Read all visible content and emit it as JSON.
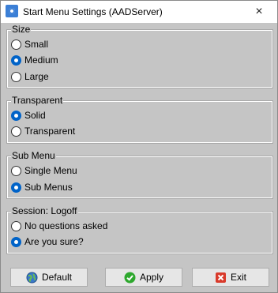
{
  "window": {
    "title": "Start Menu Settings (AADServer)",
    "close_glyph": "×",
    "app_icon": "settings-app-icon"
  },
  "groups": {
    "size": {
      "label": "Size",
      "options": [
        {
          "label": "Small",
          "checked": false
        },
        {
          "label": "Medium",
          "checked": true
        },
        {
          "label": "Large",
          "checked": false
        }
      ]
    },
    "transparent": {
      "label": "Transparent",
      "options": [
        {
          "label": "Solid",
          "checked": true
        },
        {
          "label": "Transparent",
          "checked": false
        }
      ]
    },
    "submenu": {
      "label": "Sub Menu",
      "options": [
        {
          "label": "Single Menu",
          "checked": false
        },
        {
          "label": "Sub Menus",
          "checked": true
        }
      ]
    },
    "logoff": {
      "label": "Session: Logoff",
      "options": [
        {
          "label": "No questions asked",
          "checked": false
        },
        {
          "label": "Are you sure?",
          "checked": true
        }
      ]
    }
  },
  "buttons": {
    "default_label": "Default",
    "apply_label": "Apply",
    "exit_label": "Exit",
    "default_icon": "globe-icon",
    "apply_icon": "checkmark-icon",
    "exit_icon": "close-x-icon"
  },
  "colors": {
    "background": "#c5c5c5",
    "radio_checked": "#0063c8",
    "apply_green": "#2ea82e",
    "exit_red": "#d93a2b"
  }
}
